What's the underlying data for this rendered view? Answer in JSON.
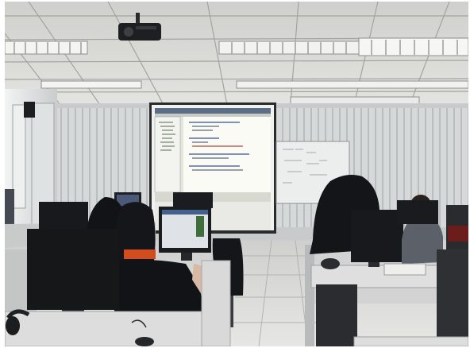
{
  "scene": {
    "kind": "classroom computer lab with projector",
    "icons": [
      "ceiling-projector-icon",
      "projection-screen-icon",
      "whiteboard-icon",
      "monitor-icon",
      "student-icon",
      "mouse-icon",
      "speaker-icon",
      "air-conditioner-icon"
    ],
    "colors": {
      "ceiling": "#d8d8d5",
      "ceiling_grid": "#9a9a98",
      "blinds": "#cfd3d4",
      "wall_left": "#b9bcbd",
      "floor": "#d3d4d2",
      "screen_ui": "#e4e6dc",
      "screen_toolbar": "#5b6e86",
      "monitor": "#1c1d20",
      "desk": "#dcdddc",
      "dark_figure": "#141518",
      "shirt_orange": "#d24c21"
    }
  }
}
